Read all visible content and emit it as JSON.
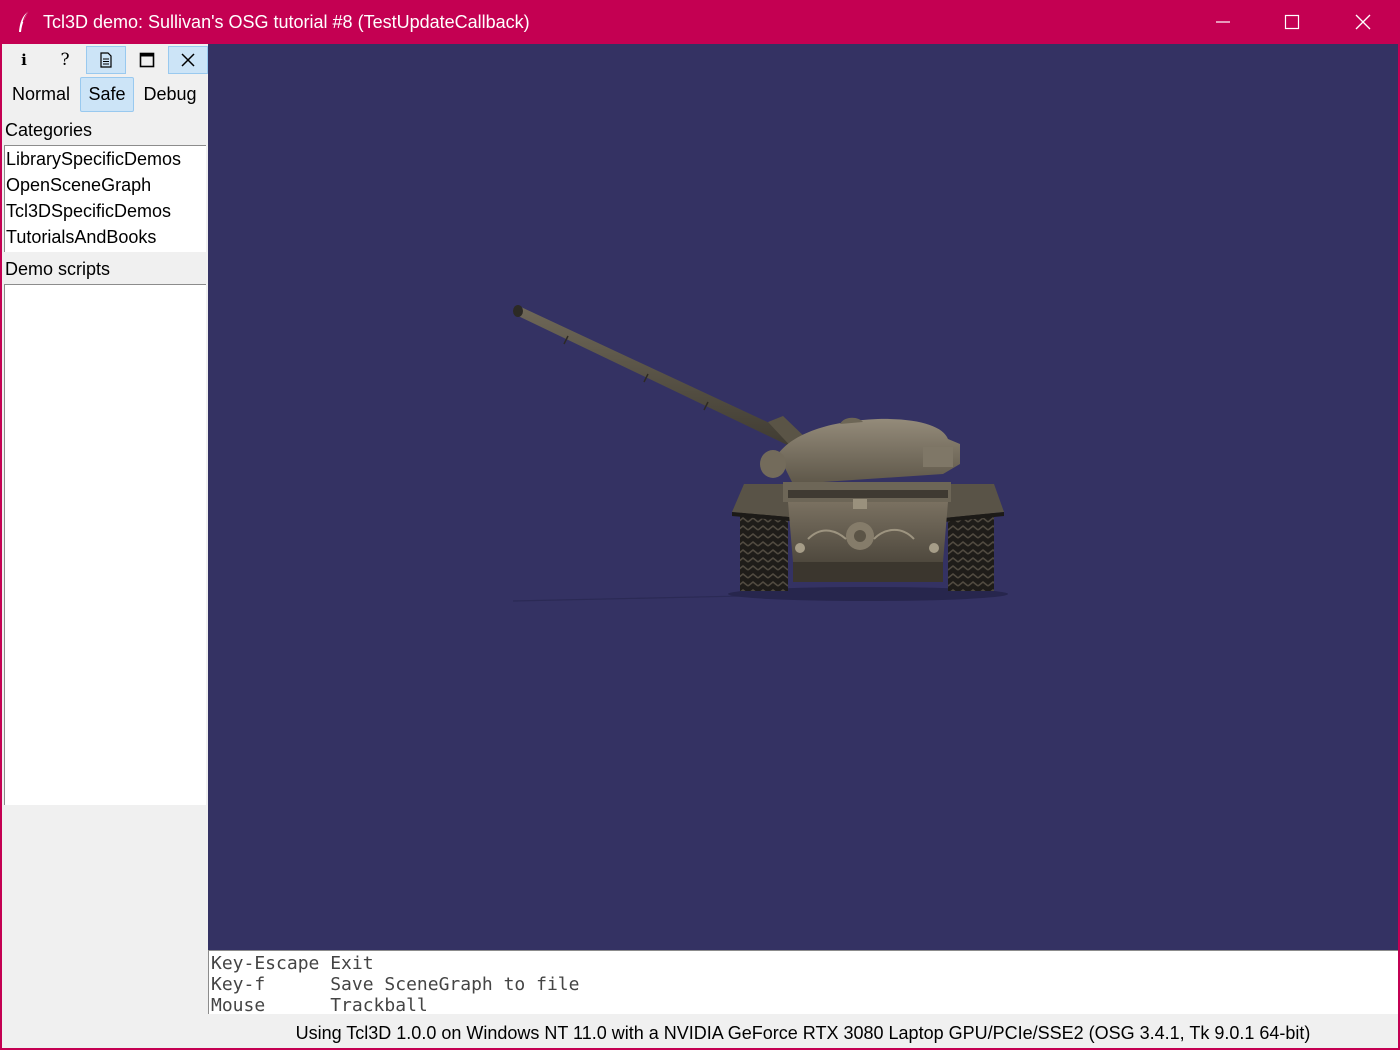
{
  "window": {
    "title": "Tcl3D demo: Sullivan's OSG tutorial #8 (TestUpdateCallback)",
    "accent_color": "#c40052"
  },
  "toolbar": {
    "tools": [
      {
        "icon": "info-icon",
        "glyph": "i"
      },
      {
        "icon": "help-icon",
        "glyph": "?"
      },
      {
        "icon": "document-icon"
      },
      {
        "icon": "maximize-window-icon"
      },
      {
        "icon": "close-icon"
      }
    ]
  },
  "modes": {
    "normal": "Normal",
    "safe": "Safe",
    "debug": "Debug",
    "selected": "Safe"
  },
  "categories": {
    "label": "Categories",
    "items": [
      "LibrarySpecificDemos",
      "OpenSceneGraph",
      "Tcl3DSpecificDemos",
      "TutorialsAndBooks"
    ]
  },
  "demo_scripts": {
    "label": "Demo scripts",
    "items": []
  },
  "viewport": {
    "background": "#343263",
    "scene": "tank-model"
  },
  "help": {
    "lines": [
      "Key-Escape Exit",
      "Key-f      Save SceneGraph to file",
      "Mouse      Trackball"
    ]
  },
  "status": {
    "text": "Using Tcl3D 1.0.0 on Windows NT 11.0 with a NVIDIA GeForce RTX 3080 Laptop GPU/PCIe/SSE2 (OSG 3.4.1, Tk 9.0.1 64-bit)"
  }
}
